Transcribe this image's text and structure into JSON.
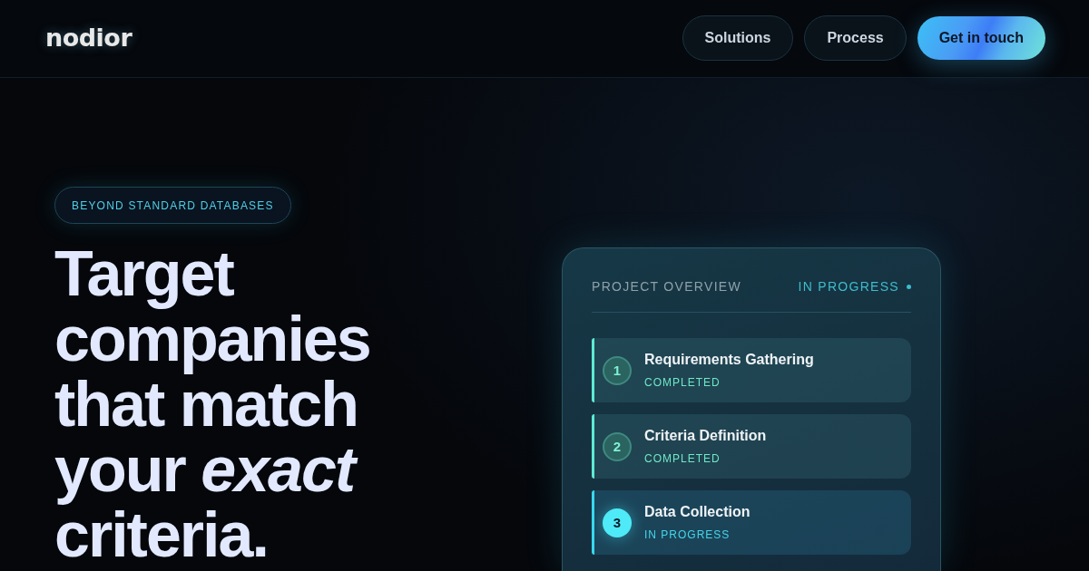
{
  "header": {
    "logo": "nodior",
    "nav": [
      {
        "label": "Solutions",
        "kind": "link"
      },
      {
        "label": "Process",
        "kind": "link"
      },
      {
        "label": "Get in touch",
        "kind": "cta"
      }
    ]
  },
  "hero": {
    "badge": "BEYOND STANDARD DATABASES",
    "heading": "Target companies that match your *exact* criteria."
  },
  "project_card": {
    "title": "PROJECT OVERVIEW",
    "status": "IN PROGRESS",
    "steps": [
      {
        "number": "1",
        "title": "Requirements Gathering",
        "status": "COMPLETED",
        "kind": "completed"
      },
      {
        "number": "2",
        "title": "Criteria Definition",
        "status": "COMPLETED",
        "kind": "completed"
      },
      {
        "number": "3",
        "title": "Data Collection",
        "status": "IN PROGRESS",
        "kind": "in_progress"
      }
    ]
  }
}
